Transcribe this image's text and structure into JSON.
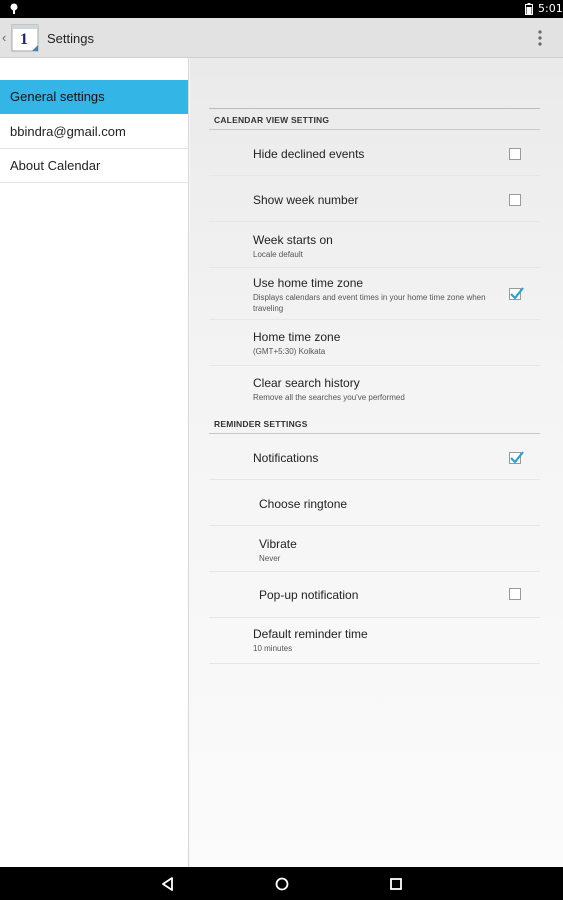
{
  "status_bar": {
    "time": "5:01"
  },
  "action_bar": {
    "title": "Settings",
    "app_icon_number": "1"
  },
  "sidebar": {
    "items": [
      {
        "label": "General settings",
        "active": true
      },
      {
        "label": "bbindra@gmail.com",
        "active": false
      },
      {
        "label": "About Calendar",
        "active": false
      }
    ]
  },
  "sections": {
    "calendar_view": {
      "header": "CALENDAR VIEW SETTING",
      "hide_declined": {
        "title": "Hide declined events",
        "checked": false
      },
      "show_week_number": {
        "title": "Show week number",
        "checked": false
      },
      "week_starts_on": {
        "title": "Week starts on",
        "summary": "Locale default"
      },
      "use_home_tz": {
        "title": "Use home time zone",
        "summary": "Displays calendars and event times in your home time zone when traveling",
        "checked": true
      },
      "home_tz": {
        "title": "Home time zone",
        "summary": "(GMT+5:30) Kolkata"
      },
      "clear_search": {
        "title": "Clear search history",
        "summary": "Remove all the searches you've performed"
      }
    },
    "reminder": {
      "header": "REMINDER SETTINGS",
      "notifications": {
        "title": "Notifications",
        "checked": true
      },
      "ringtone": {
        "title": "Choose ringtone"
      },
      "vibrate": {
        "title": "Vibrate",
        "summary": "Never"
      },
      "popup": {
        "title": "Pop-up notification",
        "checked": false
      },
      "default_reminder": {
        "title": "Default reminder time",
        "summary": "10 minutes"
      }
    }
  },
  "colors": {
    "accent": "#33b5e5",
    "check": "#2e9fd4"
  }
}
